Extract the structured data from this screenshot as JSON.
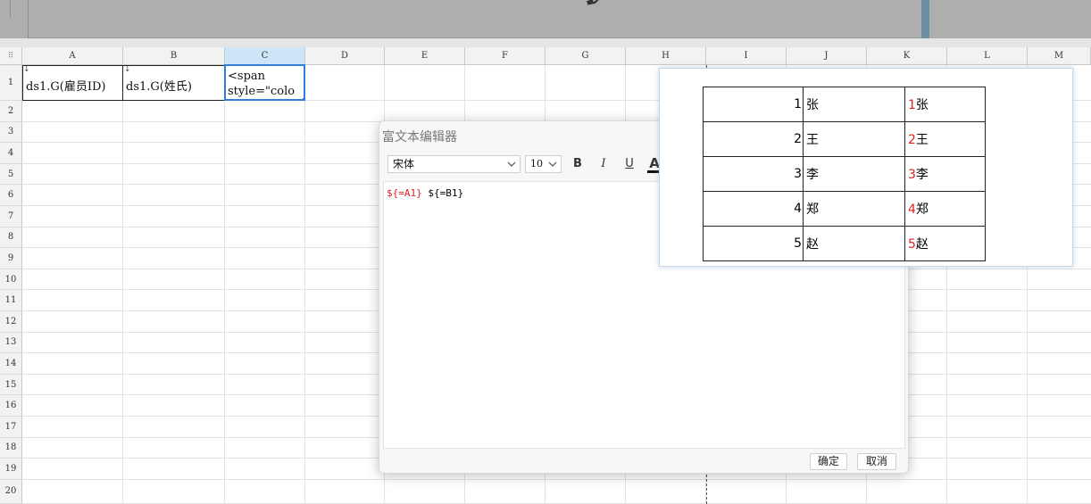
{
  "sheet": {
    "columns": [
      "A",
      "B",
      "C",
      "D",
      "E",
      "F",
      "G",
      "H",
      "I",
      "J",
      "K",
      "L",
      "M"
    ],
    "rows": [
      "1",
      "2",
      "3",
      "4",
      "5",
      "6",
      "7",
      "8",
      "9",
      "10",
      "11",
      "12",
      "13",
      "14",
      "15",
      "16",
      "17",
      "18",
      "19",
      "20"
    ],
    "corner_icon": "grid-dots-icon",
    "cells": {
      "A1": "ds1.G(雇员ID)",
      "B1": "ds1.G(姓氏)",
      "C1": "<span\nstyle=\"colo"
    }
  },
  "dialog": {
    "title": "富文本编辑器",
    "font": "宋体",
    "size": "10",
    "toolbar": {
      "bold": "B",
      "italic": "I",
      "underline": "U",
      "font_color": "A"
    },
    "content": {
      "part1": "${=A1}",
      "part2": "${=B1}"
    },
    "ok_label": "确定",
    "cancel_label": "取消"
  },
  "preview": {
    "rows": [
      {
        "num": "1",
        "name": "张",
        "combo_num": "1",
        "combo_name": "张"
      },
      {
        "num": "2",
        "name": "王",
        "combo_num": "2",
        "combo_name": "王"
      },
      {
        "num": "3",
        "name": "李",
        "combo_num": "3",
        "combo_name": "李"
      },
      {
        "num": "4",
        "name": "郑",
        "combo_num": "4",
        "combo_name": "郑"
      },
      {
        "num": "5",
        "name": "赵",
        "combo_num": "5",
        "combo_name": "赵"
      }
    ]
  },
  "colors": {
    "selection": "#2f7fd8",
    "highlight_text": "#dd2222"
  }
}
